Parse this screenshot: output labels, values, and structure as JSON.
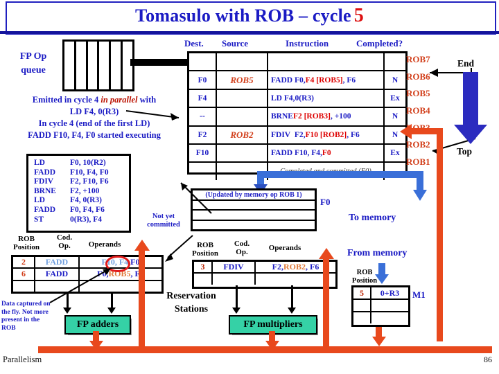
{
  "title": {
    "main": "Tomasulo with ROB – cycle ",
    "cycle": "5"
  },
  "fp_queue": {
    "label_line1": "FP Op",
    "label_line2": "queue",
    "slots": 6
  },
  "notes": {
    "emitted_1a": "Emitted in cycle 4 ",
    "emitted_1b": "in parallel",
    "emitted_1c": " with",
    "emitted_2": "LD F4, 0(R3)",
    "emitted_3": "In cycle 4 (end of the first  LD)",
    "emitted_4": "FADD F10, F4, F0  started executing",
    "not_committed": "Not yet committed",
    "data_captured": "Data captured on the fly. Not more present in the ROB"
  },
  "instruction_list": [
    {
      "op": "LD",
      "operands": "F0, 10(R2)"
    },
    {
      "op": "FADD",
      "operands": "F10, F4, F0"
    },
    {
      "op": "FDIV",
      "operands": "F2, F10, F6"
    },
    {
      "op": "BRNE",
      "operands": "F2, +100"
    },
    {
      "op": "LD",
      "operands": "F4, 0(R3)"
    },
    {
      "op": "FADD",
      "operands": "F0, F4, F6"
    },
    {
      "op": "ST",
      "operands": "0(R3), F4"
    }
  ],
  "rob": {
    "headers": {
      "dest": "Dest.",
      "source": "Source",
      "instruction": "Instruction",
      "completed": "Completed?"
    },
    "rows": [
      {
        "name": "ROB7",
        "dest": "",
        "source": "",
        "instruction": "",
        "completed": ""
      },
      {
        "name": "ROB6",
        "dest": "F0",
        "source": "ROB5",
        "instruction": "FADD F0, F4 [ROB5], F6",
        "completed": "N"
      },
      {
        "name": "ROB5",
        "dest": "F4",
        "source": "",
        "instruction": "LD     F4,0(R3)",
        "completed": "Ex"
      },
      {
        "name": "ROB4",
        "dest": "--",
        "source": "",
        "instruction": "BRNE F2 [ROB3], +100",
        "completed": "N"
      },
      {
        "name": "ROB3",
        "dest": "F2",
        "source": "ROB2",
        "instruction": "FDIV  F2, F10 [ROB2], F6",
        "completed": "N"
      },
      {
        "name": "ROB2",
        "dest": "F10",
        "source": "",
        "instruction": "FADD F10, F4, F0",
        "completed": "Ex"
      },
      {
        "name": "ROB1",
        "dest": "",
        "source": "",
        "instruction": "Completed and committed (F0)",
        "completed": ""
      }
    ],
    "end_label": "End",
    "top_label": "Top"
  },
  "register_file": {
    "row1": "(Updated by memory op ROB 1)",
    "f0_label": "F0"
  },
  "rs_adders": {
    "headers": {
      "pos": "ROB Position",
      "op": "Cod. Op.",
      "operands": "Operands"
    },
    "rows": [
      {
        "pos": "2",
        "op": "FADD",
        "operands_a": "F10, F4, ",
        "operands_b": "F0"
      },
      {
        "pos": "6",
        "op": "FADD",
        "operands_a": "F0, ",
        "operands_b": "ROB5",
        "operands_c": ", F6"
      },
      {
        "pos": "",
        "op": "",
        "operands_a": ""
      }
    ]
  },
  "rs_mult": {
    "headers": {
      "pos": "ROB Position",
      "op": "Cod. Op.",
      "operands": "Operands"
    },
    "rows": [
      {
        "pos": "3",
        "op": "FDIV",
        "operands_a": "F2, ",
        "operands_b": "ROB2",
        "operands_c": ", F6"
      },
      {
        "pos": "",
        "op": "",
        "operands_a": ""
      }
    ]
  },
  "reservation_stations_caption": {
    "line1": "Reservation",
    "line2": "Stations"
  },
  "functional_units": {
    "adders": "FP adders",
    "multipliers": "FP multipliers"
  },
  "memory": {
    "to_memory": "To memory",
    "from_memory": "From memory",
    "head_line1": "ROB",
    "head_line2": "Position",
    "rows": [
      {
        "pos": "5",
        "addr": "0+R3"
      },
      {
        "pos": "",
        "addr": ""
      },
      {
        "pos": "",
        "addr": ""
      }
    ],
    "unit_label": "M1"
  },
  "footer": {
    "left": "Parallelism",
    "right": "86"
  },
  "colors": {
    "title_blue": "#1b1bc4",
    "cycle_red": "#dd1111",
    "rob_label_orange": "#d2401c",
    "cdb_orange": "#e8491d",
    "bus_blue": "#3a6fd8",
    "fu_green": "#35d1a6"
  }
}
